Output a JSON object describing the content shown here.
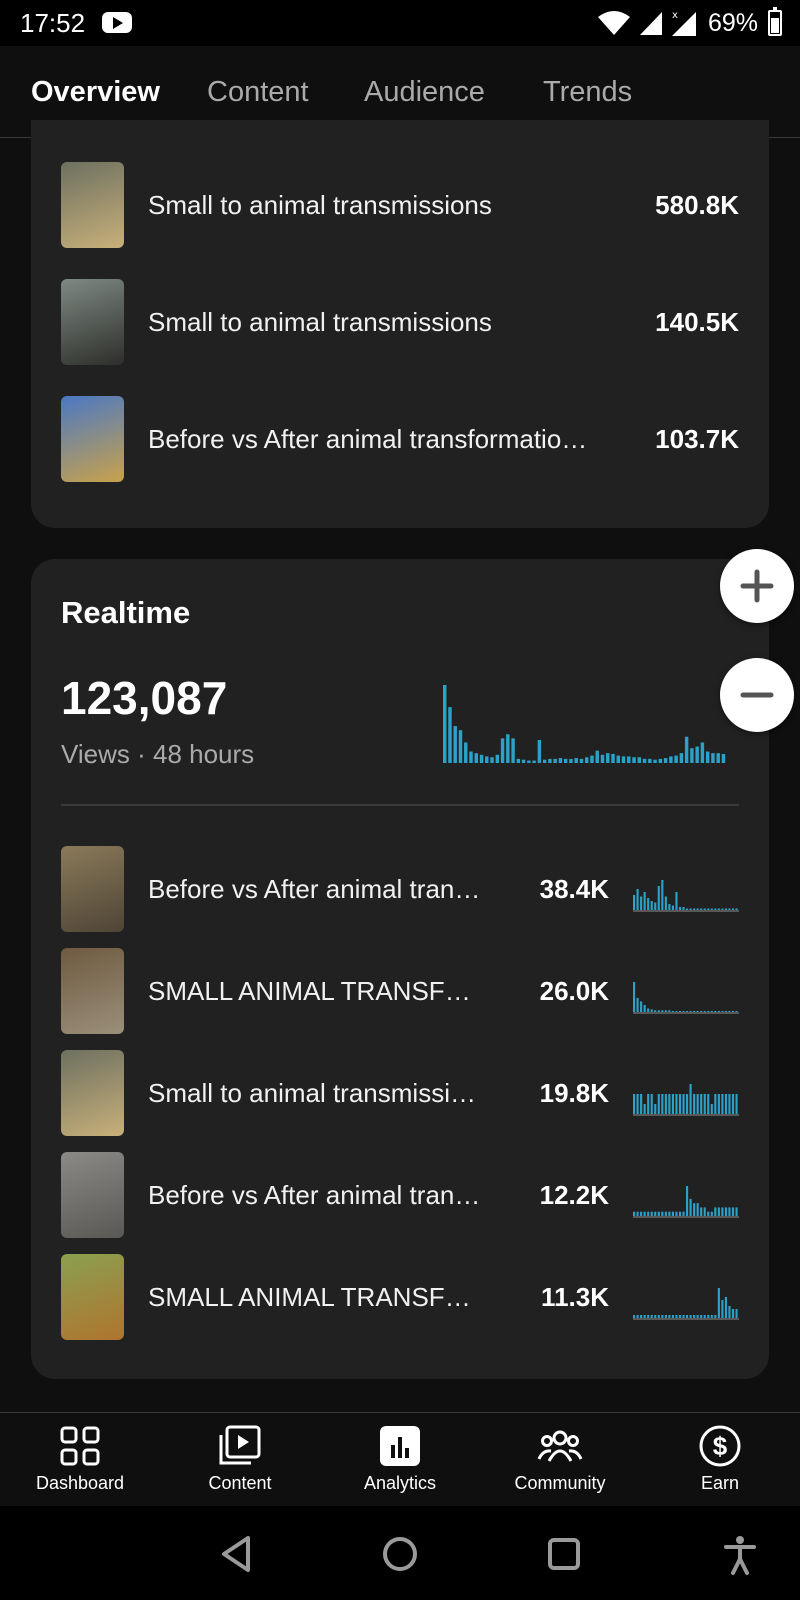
{
  "status_bar": {
    "time": "17:52",
    "battery": "69%"
  },
  "tabs": [
    {
      "label": "Overview",
      "active": true
    },
    {
      "label": "Content",
      "active": false
    },
    {
      "label": "Audience",
      "active": false
    },
    {
      "label": "Trends",
      "active": false
    }
  ],
  "top_content": [
    {
      "title": "Small to animal transmissions",
      "value": "580.8K",
      "thumb_colors": [
        "#6d7060",
        "#c8b07a"
      ]
    },
    {
      "title": "Small to animal transmissions",
      "value": "140.5K",
      "thumb_colors": [
        "#7f8a84",
        "#2d2e2a"
      ]
    },
    {
      "title": "Before vs After animal transformatio…",
      "value": "103.7K",
      "thumb_colors": [
        "#4a78c4",
        "#c9a24a"
      ]
    }
  ],
  "realtime": {
    "heading": "Realtime",
    "views": "123,087",
    "caption": "Views · 48 hours",
    "bar_color": "#2ba3c9",
    "histogram": [
      95,
      68,
      45,
      40,
      25,
      14,
      12,
      10,
      8,
      7,
      10,
      30,
      35,
      30,
      5,
      4,
      3,
      3,
      28,
      4,
      5,
      5,
      6,
      5,
      5,
      6,
      5,
      7,
      9,
      15,
      10,
      12,
      11,
      9,
      8,
      8,
      7,
      7,
      5,
      5,
      4,
      5,
      6,
      8,
      9,
      12,
      32,
      18,
      20,
      25,
      14,
      12,
      12,
      11
    ]
  },
  "realtime_items": [
    {
      "title": "Before vs After animal tran…",
      "value": "38.4K",
      "thumb_colors": [
        "#8a7a5a",
        "#4f4536"
      ],
      "spark": [
        10,
        14,
        9,
        12,
        8,
        6,
        5,
        16,
        20,
        9,
        4,
        3,
        12,
        2,
        2,
        1,
        1,
        1,
        1,
        1,
        1,
        1,
        1,
        1,
        1,
        1,
        1,
        1,
        1,
        1
      ]
    },
    {
      "title": "SMALL ANIMAL TRANSFO…",
      "value": "26.0K",
      "thumb_colors": [
        "#6e5a40",
        "#9b8f7a"
      ],
      "spark": [
        34,
        16,
        12,
        8,
        4,
        3,
        2,
        2,
        2,
        2,
        2,
        1,
        1,
        1,
        1,
        1,
        1,
        1,
        1,
        1,
        1,
        1,
        1,
        1,
        1,
        1,
        1,
        1,
        1,
        1
      ]
    },
    {
      "title": "Small to animal transmissi…",
      "value": "19.8K",
      "thumb_colors": [
        "#6d7060",
        "#c8b07a"
      ],
      "spark": [
        2,
        2,
        2,
        1,
        2,
        2,
        1,
        2,
        2,
        2,
        2,
        2,
        2,
        2,
        2,
        2,
        3,
        2,
        2,
        2,
        2,
        2,
        1,
        2,
        2,
        2,
        2,
        2,
        2,
        2
      ]
    },
    {
      "title": "Before vs After animal tran…",
      "value": "12.2K",
      "thumb_colors": [
        "#8c8a86",
        "#5a5854"
      ],
      "spark": [
        1,
        1,
        1,
        1,
        1,
        1,
        1,
        1,
        1,
        1,
        1,
        1,
        1,
        1,
        1,
        7,
        4,
        3,
        3,
        2,
        2,
        1,
        1,
        2,
        2,
        2,
        2,
        2,
        2,
        2
      ]
    },
    {
      "title": "SMALL ANIMAL TRANSFO…",
      "value": "11.3K",
      "thumb_colors": [
        "#8aa050",
        "#b0742e"
      ],
      "spark": [
        1,
        1,
        1,
        1,
        1,
        1,
        1,
        1,
        1,
        1,
        1,
        1,
        1,
        1,
        1,
        1,
        1,
        1,
        1,
        1,
        1,
        1,
        1,
        1,
        10,
        6,
        7,
        4,
        3,
        3
      ]
    }
  ],
  "bottom_nav": [
    {
      "label": "Dashboard",
      "icon": "dashboard-icon"
    },
    {
      "label": "Content",
      "icon": "content-icon"
    },
    {
      "label": "Analytics",
      "icon": "analytics-icon",
      "active": true
    },
    {
      "label": "Community",
      "icon": "community-icon"
    },
    {
      "label": "Earn",
      "icon": "earn-icon"
    }
  ]
}
